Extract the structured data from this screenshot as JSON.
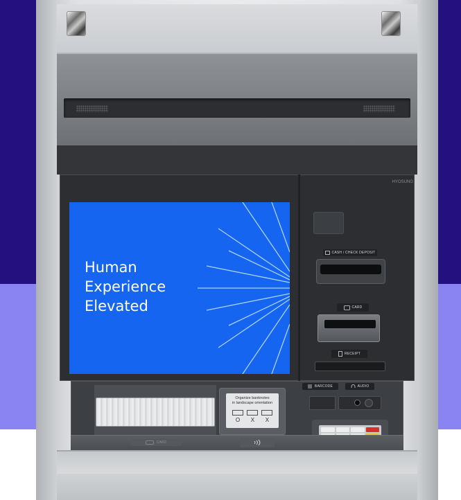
{
  "scene": {
    "background_colors": [
      "#25107f",
      "#8a83f2",
      "#ffffff"
    ],
    "subject": "atm-front-panel"
  },
  "screen": {
    "tagline_line1": "Human",
    "tagline_line2": "Experience",
    "tagline_line3": "Elevated",
    "background_color": "#1565f0",
    "text_color": "#ffffff"
  },
  "branding": {
    "manufacturer": "HYOSUNG"
  },
  "labels": {
    "cash_check_deposit": "CASH / CHECK DEPOSIT",
    "card": "CARD",
    "receipt": "RECEIPT",
    "barcode": "BARCODE",
    "audio": "AUDIO",
    "card_hint": "CARD"
  },
  "deposit_instructions": {
    "line1": "Organize banknotes",
    "line2": "in landscape orientation",
    "marks": [
      "O",
      "X",
      "X"
    ]
  },
  "icons": {
    "deposit": "deposit-icon",
    "card": "card-icon",
    "receipt": "receipt-icon",
    "barcode": "barcode-icon",
    "audio": "headphones-icon",
    "contactless": "contactless-icon"
  }
}
